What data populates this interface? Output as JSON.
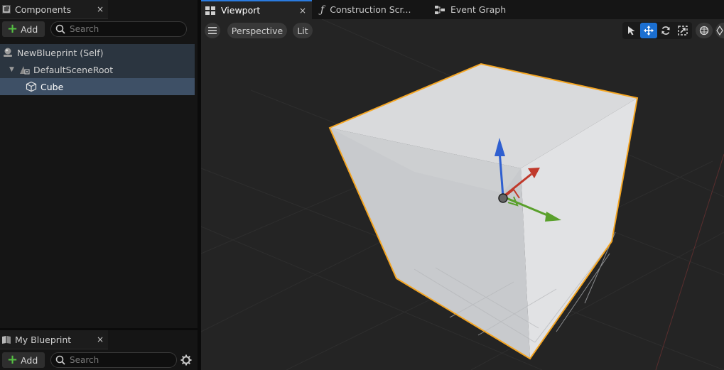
{
  "components_panel": {
    "tab_title": "Components",
    "close_glyph": "×",
    "add_label": "Add",
    "search_placeholder": "Search",
    "tree": [
      {
        "label": "NewBlueprint (Self)",
        "icon": "actor-icon"
      },
      {
        "label": "DefaultSceneRoot",
        "icon": "scene-root-icon",
        "expand_glyph": "▼"
      },
      {
        "label": "Cube",
        "icon": "cube-icon",
        "selected": true
      }
    ]
  },
  "my_blueprint_panel": {
    "tab_title": "My Blueprint",
    "close_glyph": "×",
    "add_label": "Add",
    "search_placeholder": "Search"
  },
  "editor_tabs": [
    {
      "label": "Viewport",
      "icon": "viewport-grid-icon",
      "active": true,
      "close_glyph": "×"
    },
    {
      "label": "Construction Scr...",
      "icon": "function-icon"
    },
    {
      "label": "Event Graph",
      "icon": "event-graph-icon"
    }
  ],
  "viewport_toolbar": {
    "view_mode": "Perspective",
    "lighting_mode": "Lit",
    "tools": [
      "select-icon",
      "translate-icon",
      "rotate-icon",
      "scale-icon",
      "world-space-icon"
    ]
  },
  "colors": {
    "selection_outline": "#f5a623",
    "active_tool": "#1b6fd1",
    "add_plus": "#55c143",
    "gizmo_x": "#c0392b",
    "gizmo_y": "#5aa02c",
    "gizmo_z": "#2f5fd0"
  }
}
